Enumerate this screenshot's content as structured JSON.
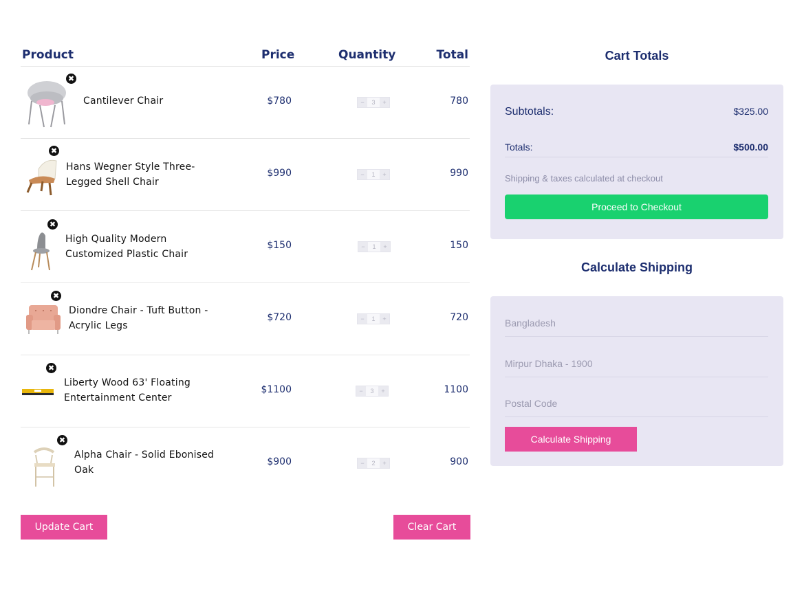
{
  "cart": {
    "headers": {
      "product": "Product",
      "price": "Price",
      "quantity": "Quantity",
      "total": "Total"
    },
    "items": [
      {
        "name": "Cantilever Chair",
        "price": "$780",
        "qty": "3",
        "total": "780",
        "image": "grey-cantilever-chair"
      },
      {
        "name": "Hans Wegner Style Three-Legged Shell Chair",
        "price": "$990",
        "qty": "1",
        "total": "990",
        "image": "shell-chair"
      },
      {
        "name": "High Quality Modern Customized Plastic Chair",
        "price": "$150",
        "qty": "1",
        "total": "150",
        "image": "plastic-chair"
      },
      {
        "name": "Diondre Chair - Tuft Button - Acrylic Legs",
        "price": "$720",
        "qty": "1",
        "total": "720",
        "image": "pink-armchair"
      },
      {
        "name": "Liberty Wood 63' Floating Entertainment Center",
        "price": "$1100",
        "qty": "3",
        "total": "1100",
        "image": "floating-shelf"
      },
      {
        "name": "Alpha Chair - Solid Ebonised Oak",
        "price": "$900",
        "qty": "2",
        "total": "900",
        "image": "oak-stool-chair"
      }
    ],
    "qty_minus": "−",
    "qty_plus": "+",
    "remove_glyph": "✖",
    "update_label": "Update Cart",
    "clear_label": "Clear Cart"
  },
  "totals": {
    "title": "Cart Totals",
    "subtotal_label": "Subtotals:",
    "subtotal_value": "$325.00",
    "total_label": "Totals:",
    "total_value": "$500.00",
    "note": "Shipping & taxes calculated at checkout",
    "checkout_label": "Proceed to Checkout"
  },
  "shipping": {
    "title": "Calculate Shipping",
    "country_placeholder": "Bangladesh",
    "city_placeholder": "Mirpur Dhaka - 1900",
    "postal_placeholder": "Postal Code",
    "button_label": "Calculate Shipping"
  },
  "colors": {
    "heading": "#1d2e6f",
    "accent_pink": "#e74c9a",
    "checkout_green": "#19d16f",
    "panel_bg": "#e8e6f3"
  }
}
